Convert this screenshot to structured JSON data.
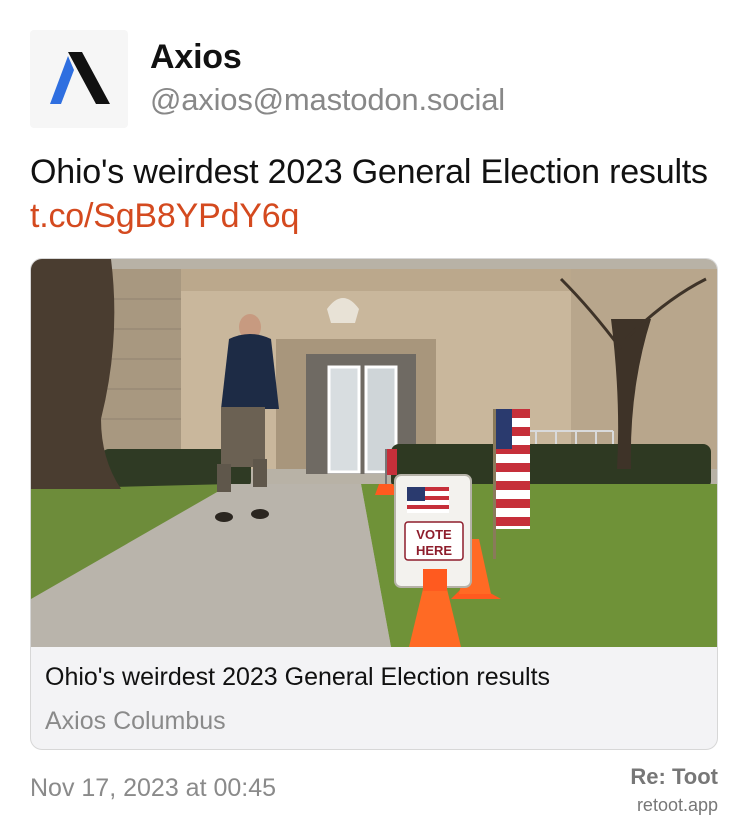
{
  "author": {
    "name": "Axios",
    "handle": "@axios@mastodon.social",
    "avatar_icon": "axios-logo-icon"
  },
  "post": {
    "text": "Ohio's weirdest 2023 General Election results ",
    "link": "t.co/SgB8YPdY6q"
  },
  "link_card": {
    "image_icon": "polling-place-photo",
    "image_sign_line1": "VOTE",
    "image_sign_line2": "HERE",
    "title": "Ohio's weirdest 2023 General Election results",
    "source": "Axios Columbus"
  },
  "footer": {
    "timestamp": "Nov 17, 2023 at 00:45",
    "brand_title": "Re: Toot",
    "brand_url": "retoot.app"
  },
  "colors": {
    "link": "#d44a1f",
    "muted": "#8a8a8a",
    "logo_blue": "#2f6fe0",
    "logo_black": "#111111"
  }
}
